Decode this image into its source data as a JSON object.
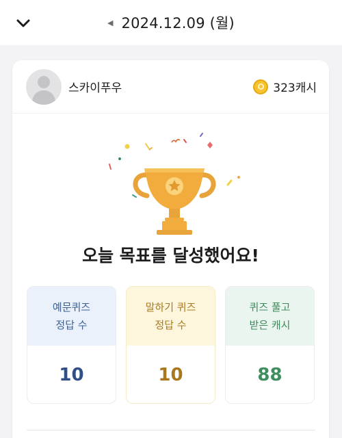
{
  "header": {
    "date": "2024.12.09 (월)"
  },
  "profile": {
    "username": "스카이푸우",
    "cash": "323캐시"
  },
  "goal_message": "오늘 목표를 달성했어요!",
  "stats": [
    {
      "line1": "예문퀴즈",
      "line2": "정답 수",
      "value": "10",
      "color": "#2f4f85"
    },
    {
      "line1": "말하기 퀴즈",
      "line2": "정답 수",
      "value": "10",
      "color": "#a8781f"
    },
    {
      "line1": "퀴즈 풀고",
      "line2": "받은 캐시",
      "value": "88",
      "color": "#3f8f5e"
    }
  ],
  "colors": {
    "trophy": "#f2ab3d",
    "coin": "#f7c32e"
  },
  "icons": {
    "collapse": "chevron-down-icon",
    "prev_date": "caret-left-icon",
    "coin": "coin-icon",
    "trophy": "trophy-icon"
  }
}
